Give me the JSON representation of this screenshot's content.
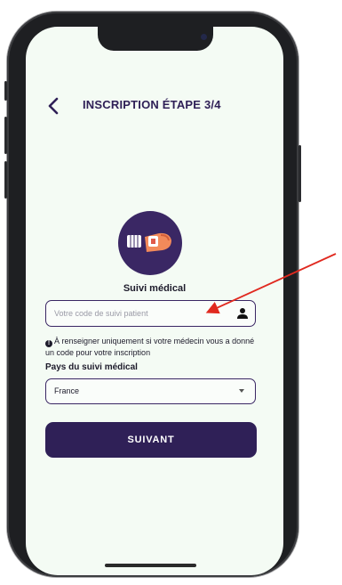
{
  "header": {
    "back_icon": "chevron-left-icon",
    "title": "INSCRIPTION ÉTAPE 3/4"
  },
  "medical": {
    "icon": "medical-bracelet-icon",
    "label": "Suivi médical"
  },
  "code_input": {
    "placeholder": "Votre code de suivi patient",
    "value": "",
    "icon": "person-icon"
  },
  "info": {
    "icon": "info-icon",
    "text": "À renseigner uniquement si votre médecin vous a donné un code pour votre inscription"
  },
  "country": {
    "label": "Pays du suivi médical",
    "selected": "France"
  },
  "next_button": {
    "label": "SUIVANT"
  },
  "colors": {
    "primary": "#2f2057",
    "screen_bg": "#f4fbf4",
    "annotation_arrow": "#e0291f"
  }
}
